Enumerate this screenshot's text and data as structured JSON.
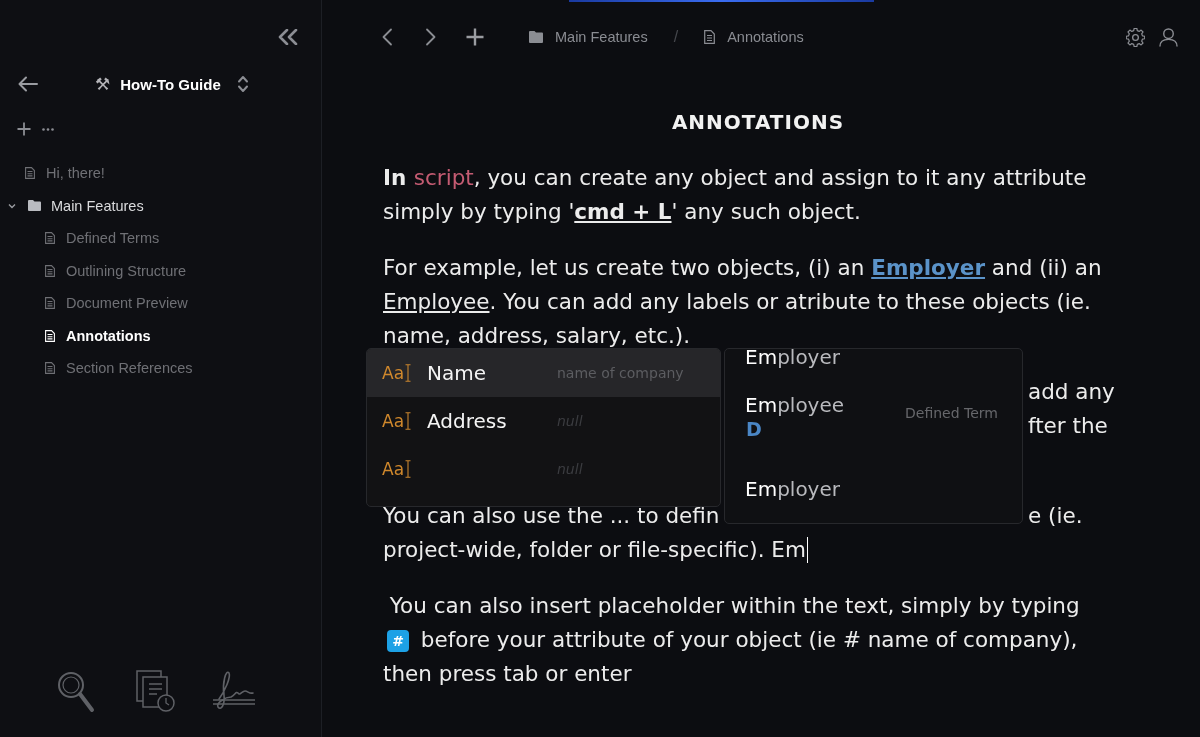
{
  "sidebar": {
    "project": {
      "icon": "⚒",
      "title": "How-To Guide"
    },
    "tree": [
      {
        "kind": "page",
        "label": "Hi, there!",
        "selected": false
      },
      {
        "kind": "folder",
        "label": "Main Features",
        "selected": false,
        "expanded": true,
        "children": [
          {
            "kind": "page",
            "label": "Defined Terms",
            "selected": false
          },
          {
            "kind": "page",
            "label": "Outlining Structure",
            "selected": false
          },
          {
            "kind": "page",
            "label": "Document Preview",
            "selected": false
          },
          {
            "kind": "page",
            "label": "Annotations",
            "selected": true
          },
          {
            "kind": "page",
            "label": "Section References",
            "selected": false
          }
        ]
      }
    ]
  },
  "toolbar": {
    "breadcrumb": [
      {
        "kind": "folder",
        "label": "Main Features"
      },
      {
        "kind": "page",
        "label": "Annotations"
      }
    ],
    "separator": "/"
  },
  "document": {
    "title": "ANNOTATIONS",
    "paragraphs": [
      {
        "segments": [
          {
            "kind": "strong",
            "text": "In "
          },
          {
            "kind": "accent",
            "text": "script"
          },
          {
            "kind": "plain",
            "text": ", you can create any object and assign to it any attribute simply by typing '"
          },
          {
            "kind": "shortcut",
            "text": "cmd + L"
          },
          {
            "kind": "plain",
            "text": "' any such object."
          }
        ]
      },
      {
        "segments": [
          {
            "kind": "plain",
            "text": "For example, let us create two objects, (i) an "
          },
          {
            "kind": "defined-term-link",
            "text": "Employer"
          },
          {
            "kind": "plain",
            "text": " and (ii) an "
          },
          {
            "kind": "term-link",
            "text": "Employee"
          },
          {
            "kind": "plain",
            "text": ". You can add any labels or atribute to these objects (ie. name, address, salary, etc.)."
          }
        ]
      }
    ],
    "covered_paragraph": {
      "visible_ends": [
        "add any",
        "fter the"
      ]
    },
    "partly_covered_paragraph": {
      "line_1_start": "You can also use the ... to defin",
      "line_1_end": "e (ie.",
      "line_2": "project-wide, folder or file-specific). Em"
    },
    "last_paragraph": {
      "segments": [
        {
          "kind": "plain",
          "text": " You can also insert placeholder within the text, simply by typing "
        },
        {
          "kind": "hash-badge",
          "text": "#"
        },
        {
          "kind": "plain",
          "text": " before your attribute of your object (ie # name of company), then press tab or enter"
        }
      ]
    }
  },
  "attribute_menu": {
    "items": [
      {
        "kind": "filled",
        "type_icon": "Aa",
        "label": "Name",
        "value": "name of company",
        "selected": true
      },
      {
        "kind": "empty",
        "type_icon": "Aa",
        "label": "Address",
        "value": "null",
        "selected": false
      },
      {
        "kind": "empty",
        "type_icon": "Aa",
        "value": "null",
        "selected": false
      }
    ]
  },
  "term_menu": {
    "items": [
      {
        "label": "**Em**ployer",
        "selected": false
      },
      {
        "label": "**Em**ployee",
        "type_letter": "D",
        "hint": "Defined Term",
        "selected": false
      },
      {
        "label": "**Em**ployer",
        "selected": false
      }
    ]
  }
}
